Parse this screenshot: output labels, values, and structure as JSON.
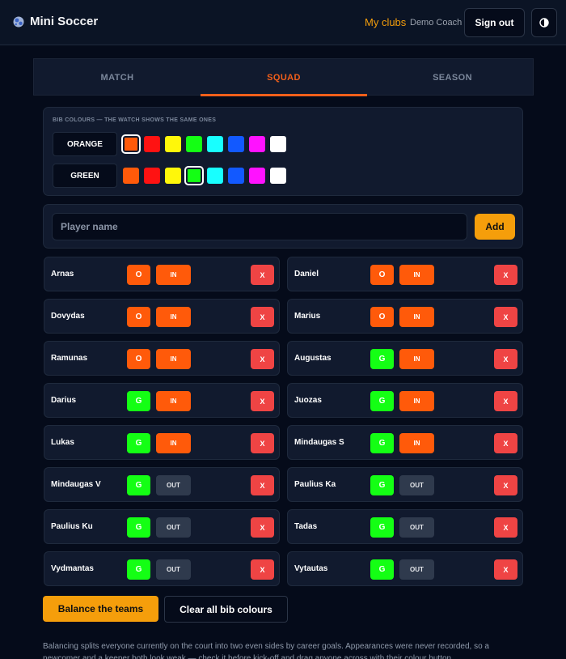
{
  "app": {
    "title": "Mini Soccer"
  },
  "header": {
    "clubs_link": "My clubs",
    "user": "Demo Coach",
    "signout_label": "Sign out"
  },
  "tabs": [
    {
      "label": "MATCH",
      "active": false
    },
    {
      "label": "SQUAD",
      "active": true
    },
    {
      "label": "SEASON",
      "active": false
    }
  ],
  "bibs": {
    "title": "BIB COLOURS — THE WATCH SHOWS THE SAME ONES",
    "palette": [
      "#ff5a0a",
      "#ff1212",
      "#fff70a",
      "#14ff14",
      "#18ffff",
      "#1259ff",
      "#ff12ff",
      "#ffffff"
    ],
    "teams": [
      {
        "label": "ORANGE",
        "selected_index": 0
      },
      {
        "label": "GREEN",
        "selected_index": 3
      }
    ]
  },
  "add_player": {
    "placeholder": "Player name",
    "add_label": "Add"
  },
  "bib_colors": {
    "O": "#ff5a0a",
    "G": "#14ff14"
  },
  "status_colors": {
    "IN": "#ff5a0a",
    "OUT": "#2f3a4d"
  },
  "remove_label": "X",
  "players": [
    {
      "name": "Arnas",
      "bib": "O",
      "status": "IN"
    },
    {
      "name": "Daniel",
      "bib": "O",
      "status": "IN"
    },
    {
      "name": "Dovydas",
      "bib": "O",
      "status": "IN"
    },
    {
      "name": "Marius",
      "bib": "O",
      "status": "IN"
    },
    {
      "name": "Ramunas",
      "bib": "O",
      "status": "IN"
    },
    {
      "name": "Augustas",
      "bib": "G",
      "status": "IN"
    },
    {
      "name": "Darius",
      "bib": "G",
      "status": "IN"
    },
    {
      "name": "Juozas",
      "bib": "G",
      "status": "IN"
    },
    {
      "name": "Lukas",
      "bib": "G",
      "status": "IN"
    },
    {
      "name": "Mindaugas S",
      "bib": "G",
      "status": "IN"
    },
    {
      "name": "Mindaugas V",
      "bib": "G",
      "status": "OUT"
    },
    {
      "name": "Paulius Ka",
      "bib": "G",
      "status": "OUT"
    },
    {
      "name": "Paulius Ku",
      "bib": "G",
      "status": "OUT"
    },
    {
      "name": "Tadas",
      "bib": "G",
      "status": "OUT"
    },
    {
      "name": "Vydmantas",
      "bib": "G",
      "status": "OUT"
    },
    {
      "name": "Vytautas",
      "bib": "G",
      "status": "OUT"
    }
  ],
  "actions": {
    "balance_label": "Balance the teams",
    "clear_label": "Clear all bib colours"
  },
  "footnote": "Balancing splits everyone currently on the court into two even sides by career goals. Appearances were never recorded, so a newcomer and a keeper both look weak — check it before kick-off and drag anyone across with their colour button."
}
